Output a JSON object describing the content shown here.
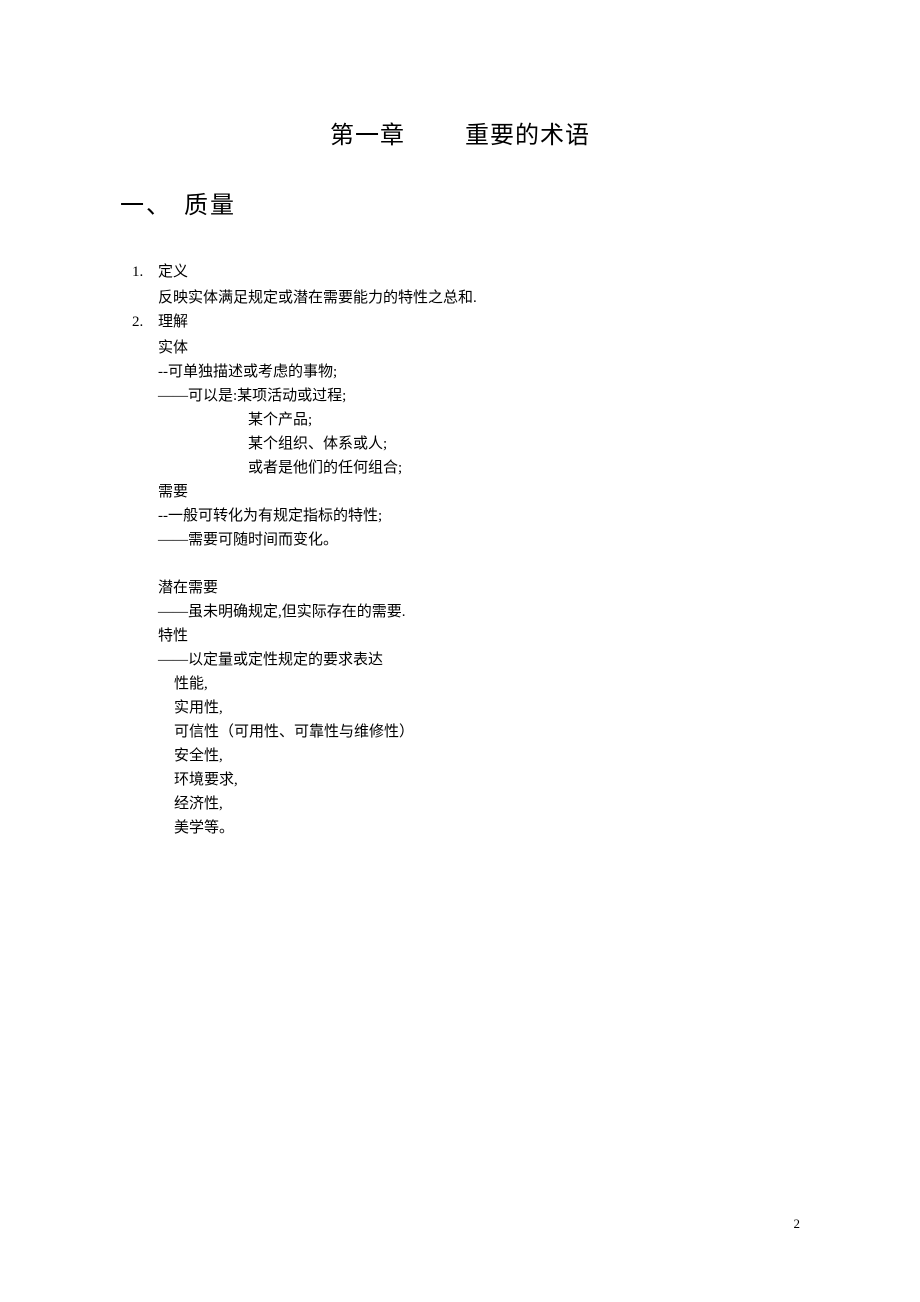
{
  "chapter": {
    "number": "第一章",
    "title": "重要的术语"
  },
  "section": {
    "number": "一、",
    "title": "质量"
  },
  "items": [
    {
      "num": "1.",
      "label": "定义",
      "lines": [
        "反映实体满足规定或潜在需要能力的特性之总和."
      ]
    },
    {
      "num": "2.",
      "label": "理解",
      "blocks": [
        {
          "heading": "实体",
          "lines": [
            "--可单独描述或考虑的事物;",
            "——可以是:某项活动或过程;"
          ],
          "sublines": [
            "某个产品;",
            "某个组织、体系或人;",
            "或者是他们的任何组合;"
          ]
        },
        {
          "heading": "需要",
          "lines": [
            "--一般可转化为有规定指标的特性;",
            "——需要可随时间而变化。"
          ]
        },
        {
          "heading": "潜在需要",
          "lines": [
            "——虽未明确规定,但实际存在的需要."
          ]
        },
        {
          "heading": "特性",
          "lines": [
            "——以定量或定性规定的要求表达"
          ],
          "proplines": [
            "性能,",
            "实用性,",
            "可信性（可用性、可靠性与维修性）",
            "安全性,",
            "环境要求,",
            "经济性,",
            "美学等。"
          ]
        }
      ]
    }
  ],
  "pageNumber": "2"
}
